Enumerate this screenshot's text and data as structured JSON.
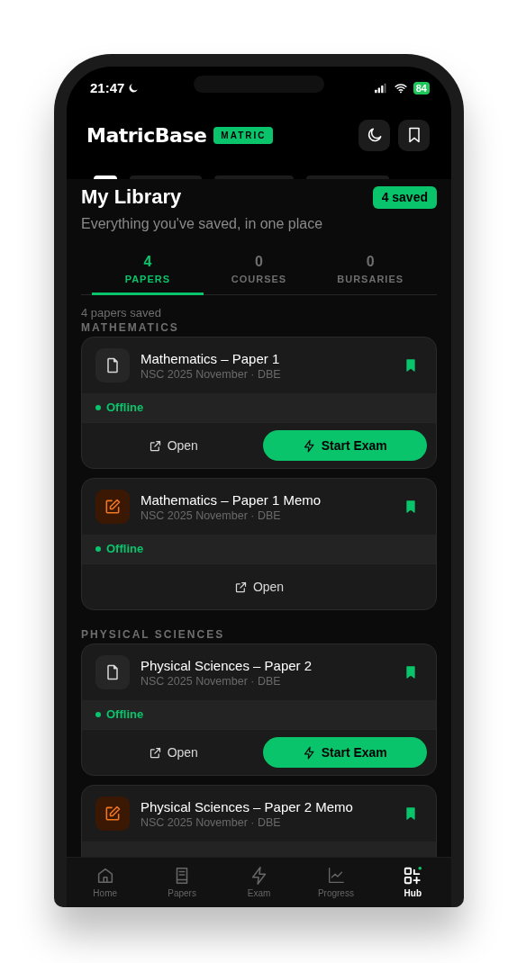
{
  "status_bar": {
    "time": "21:47",
    "battery": "84"
  },
  "header": {
    "logo": "MatricBase",
    "badge": "MATRIC"
  },
  "library": {
    "title": "My Library",
    "subtitle": "Everything you've saved, in one place",
    "saved_badge": "4 saved"
  },
  "tabs": [
    {
      "count": "4",
      "label": "PAPERS",
      "selected": true
    },
    {
      "count": "0",
      "label": "COURSES",
      "selected": false
    },
    {
      "count": "0",
      "label": "BURSARIES",
      "selected": false
    }
  ],
  "summary": "4 papers saved",
  "sections": [
    {
      "title": "MATHEMATICS",
      "papers": [
        {
          "kind": "paper",
          "title": "Mathematics – Paper 1",
          "meta": "NSC 2025 November · DBE",
          "bookmarked": true,
          "status": "Offline",
          "actions": [
            {
              "kind": "open",
              "label": "Open"
            },
            {
              "kind": "exam",
              "label": "Start Exam"
            }
          ]
        },
        {
          "kind": "memo",
          "title": "Mathematics – Paper 1 Memo",
          "meta": "NSC 2025 November · DBE",
          "bookmarked": true,
          "status": "Offline",
          "actions": [
            {
              "kind": "open",
              "label": "Open"
            }
          ]
        }
      ]
    },
    {
      "title": "PHYSICAL SCIENCES",
      "papers": [
        {
          "kind": "paper",
          "title": "Physical Sciences – Paper 2",
          "meta": "NSC 2025 November · DBE",
          "bookmarked": true,
          "status": "Offline",
          "actions": [
            {
              "kind": "open",
              "label": "Open"
            },
            {
              "kind": "exam",
              "label": "Start Exam"
            }
          ]
        },
        {
          "kind": "memo",
          "title": "Physical Sciences – Paper 2 Memo",
          "meta": "NSC 2025 November · DBE",
          "bookmarked": true
        }
      ]
    }
  ],
  "nav": [
    {
      "kind": "home",
      "label": "Home",
      "selected": false
    },
    {
      "kind": "papers",
      "label": "Papers",
      "selected": false
    },
    {
      "kind": "exam",
      "label": "Exam",
      "selected": false
    },
    {
      "kind": "progress",
      "label": "Progress",
      "selected": false
    },
    {
      "kind": "hub",
      "label": "Hub",
      "selected": true
    }
  ]
}
